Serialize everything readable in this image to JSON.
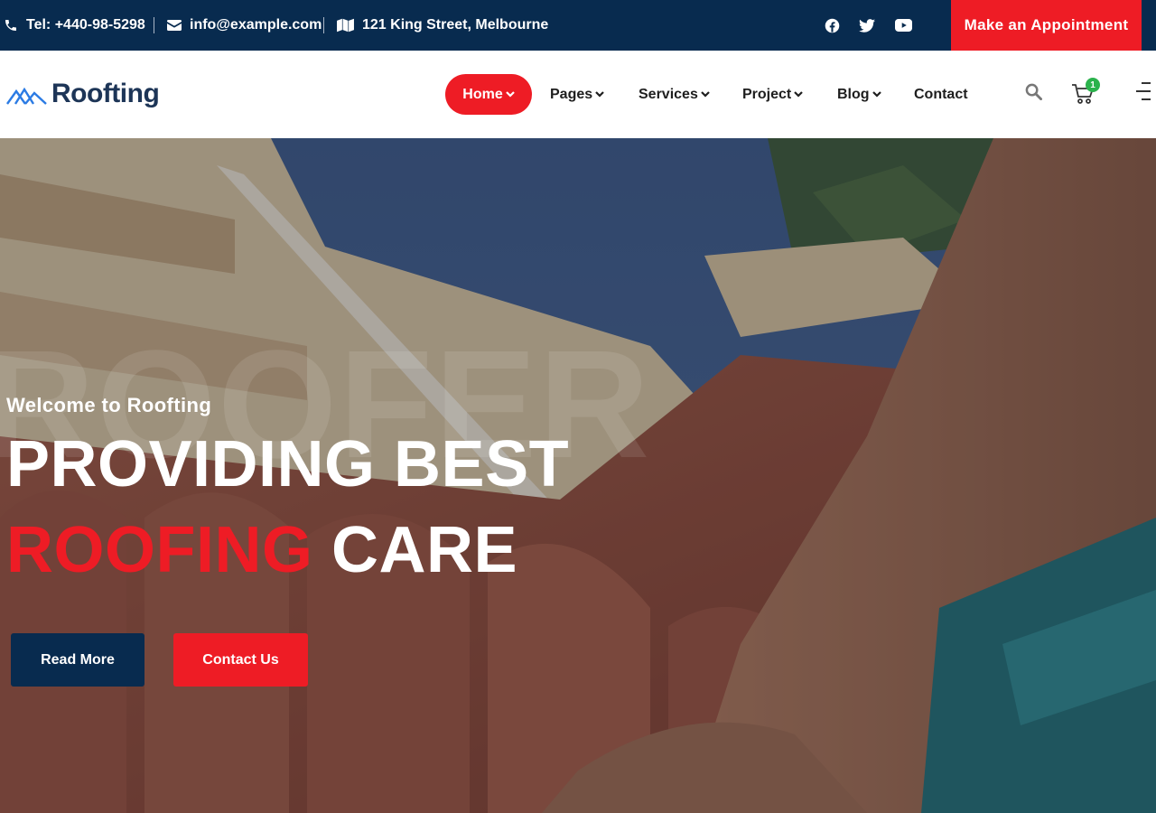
{
  "topbar": {
    "phone": "Tel: +440-98-5298",
    "email": "info@example.com",
    "address": "121 King Street, Melbourne",
    "social_icons": [
      "facebook-icon",
      "twitter-icon",
      "youtube-icon"
    ],
    "appointment_label": "Make an Appointment"
  },
  "header": {
    "logo_text": "Roofting",
    "nav": [
      {
        "label": "Home",
        "has_dropdown": true,
        "active": true
      },
      {
        "label": "Pages",
        "has_dropdown": true
      },
      {
        "label": "Services",
        "has_dropdown": true
      },
      {
        "label": "Project",
        "has_dropdown": true
      },
      {
        "label": "Blog",
        "has_dropdown": true
      },
      {
        "label": "Contact",
        "has_dropdown": false
      }
    ],
    "cart_count": "1",
    "icons": [
      "search-icon",
      "cart-icon",
      "menu-icon"
    ]
  },
  "hero": {
    "watermark": "ROOFER",
    "subtitle": "Welcome to Roofting",
    "title_line1": "PROVIDING BEST",
    "title_accent": "ROOFING",
    "title_rest": "CARE",
    "read_more_label": "Read More",
    "contact_label": "Contact Us"
  },
  "colors": {
    "navy": "#082b4f",
    "accent_red": "#ee1c25",
    "badge_green": "#2bb24c"
  }
}
